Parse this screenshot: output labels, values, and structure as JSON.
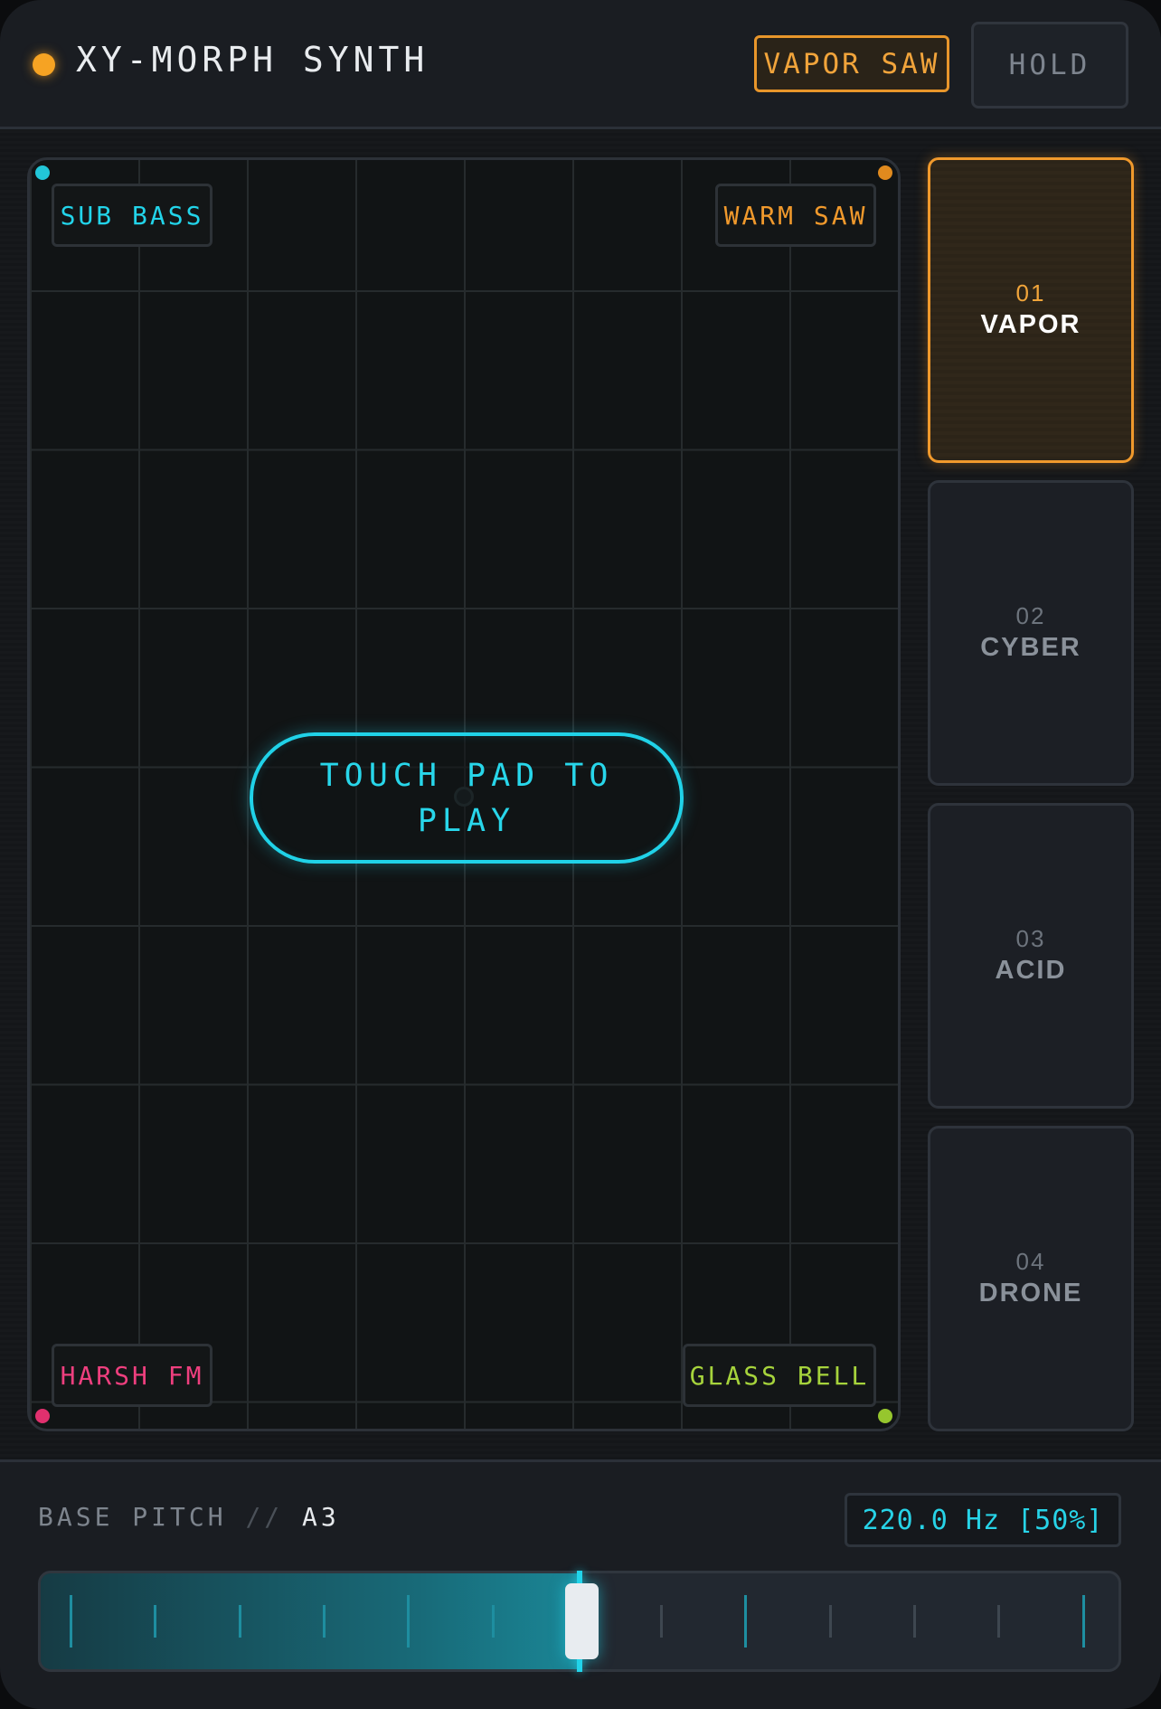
{
  "header": {
    "title": "XY-MORPH SYNTH",
    "status_color": "#f6a323",
    "current_patch": "VAPOR SAW",
    "hold_label": "HOLD"
  },
  "pad": {
    "prompt": "TOUCH PAD TO PLAY",
    "corners": {
      "top_left": {
        "label": "SUB BASS",
        "color": "#22d4ea"
      },
      "top_right": {
        "label": "WARM SAW",
        "color": "#f0992c"
      },
      "bottom_left": {
        "label": "HARSH FM",
        "color": "#ee3f7e"
      },
      "bottom_right": {
        "label": "GLASS BELL",
        "color": "#a6d33c"
      }
    }
  },
  "presets": [
    {
      "number": "01",
      "name": "VAPOR",
      "active": true
    },
    {
      "number": "02",
      "name": "CYBER",
      "active": false
    },
    {
      "number": "03",
      "name": "ACID",
      "active": false
    },
    {
      "number": "04",
      "name": "DRONE",
      "active": false
    }
  ],
  "pitch": {
    "label": "BASE PITCH",
    "separator": "//",
    "note": "A3",
    "readout": "220.0 Hz [50%]",
    "value_fraction": 0.5,
    "accent_color": "#22d4ea"
  }
}
